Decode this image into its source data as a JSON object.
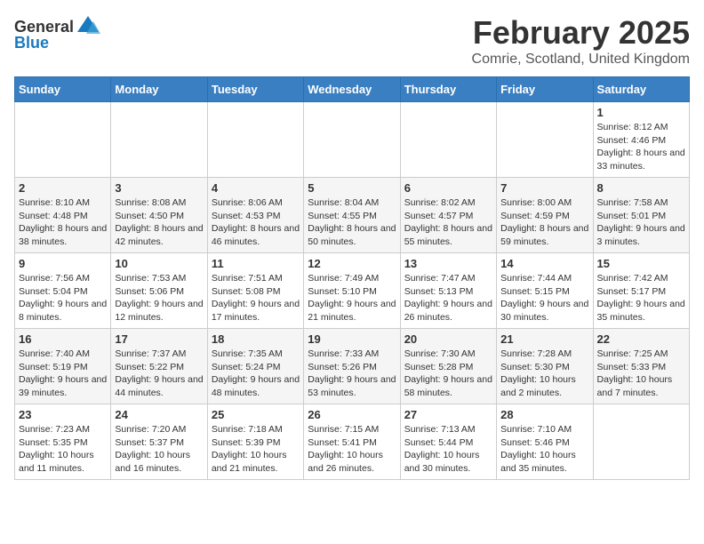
{
  "header": {
    "logo": {
      "text_general": "General",
      "text_blue": "Blue"
    },
    "title": "February 2025",
    "subtitle": "Comrie, Scotland, United Kingdom"
  },
  "weekdays": [
    "Sunday",
    "Monday",
    "Tuesday",
    "Wednesday",
    "Thursday",
    "Friday",
    "Saturday"
  ],
  "weeks": [
    [
      {
        "day": "",
        "info": ""
      },
      {
        "day": "",
        "info": ""
      },
      {
        "day": "",
        "info": ""
      },
      {
        "day": "",
        "info": ""
      },
      {
        "day": "",
        "info": ""
      },
      {
        "day": "",
        "info": ""
      },
      {
        "day": "1",
        "info": "Sunrise: 8:12 AM\nSunset: 4:46 PM\nDaylight: 8 hours and 33 minutes."
      }
    ],
    [
      {
        "day": "2",
        "info": "Sunrise: 8:10 AM\nSunset: 4:48 PM\nDaylight: 8 hours and 38 minutes."
      },
      {
        "day": "3",
        "info": "Sunrise: 8:08 AM\nSunset: 4:50 PM\nDaylight: 8 hours and 42 minutes."
      },
      {
        "day": "4",
        "info": "Sunrise: 8:06 AM\nSunset: 4:53 PM\nDaylight: 8 hours and 46 minutes."
      },
      {
        "day": "5",
        "info": "Sunrise: 8:04 AM\nSunset: 4:55 PM\nDaylight: 8 hours and 50 minutes."
      },
      {
        "day": "6",
        "info": "Sunrise: 8:02 AM\nSunset: 4:57 PM\nDaylight: 8 hours and 55 minutes."
      },
      {
        "day": "7",
        "info": "Sunrise: 8:00 AM\nSunset: 4:59 PM\nDaylight: 8 hours and 59 minutes."
      },
      {
        "day": "8",
        "info": "Sunrise: 7:58 AM\nSunset: 5:01 PM\nDaylight: 9 hours and 3 minutes."
      }
    ],
    [
      {
        "day": "9",
        "info": "Sunrise: 7:56 AM\nSunset: 5:04 PM\nDaylight: 9 hours and 8 minutes."
      },
      {
        "day": "10",
        "info": "Sunrise: 7:53 AM\nSunset: 5:06 PM\nDaylight: 9 hours and 12 minutes."
      },
      {
        "day": "11",
        "info": "Sunrise: 7:51 AM\nSunset: 5:08 PM\nDaylight: 9 hours and 17 minutes."
      },
      {
        "day": "12",
        "info": "Sunrise: 7:49 AM\nSunset: 5:10 PM\nDaylight: 9 hours and 21 minutes."
      },
      {
        "day": "13",
        "info": "Sunrise: 7:47 AM\nSunset: 5:13 PM\nDaylight: 9 hours and 26 minutes."
      },
      {
        "day": "14",
        "info": "Sunrise: 7:44 AM\nSunset: 5:15 PM\nDaylight: 9 hours and 30 minutes."
      },
      {
        "day": "15",
        "info": "Sunrise: 7:42 AM\nSunset: 5:17 PM\nDaylight: 9 hours and 35 minutes."
      }
    ],
    [
      {
        "day": "16",
        "info": "Sunrise: 7:40 AM\nSunset: 5:19 PM\nDaylight: 9 hours and 39 minutes."
      },
      {
        "day": "17",
        "info": "Sunrise: 7:37 AM\nSunset: 5:22 PM\nDaylight: 9 hours and 44 minutes."
      },
      {
        "day": "18",
        "info": "Sunrise: 7:35 AM\nSunset: 5:24 PM\nDaylight: 9 hours and 48 minutes."
      },
      {
        "day": "19",
        "info": "Sunrise: 7:33 AM\nSunset: 5:26 PM\nDaylight: 9 hours and 53 minutes."
      },
      {
        "day": "20",
        "info": "Sunrise: 7:30 AM\nSunset: 5:28 PM\nDaylight: 9 hours and 58 minutes."
      },
      {
        "day": "21",
        "info": "Sunrise: 7:28 AM\nSunset: 5:30 PM\nDaylight: 10 hours and 2 minutes."
      },
      {
        "day": "22",
        "info": "Sunrise: 7:25 AM\nSunset: 5:33 PM\nDaylight: 10 hours and 7 minutes."
      }
    ],
    [
      {
        "day": "23",
        "info": "Sunrise: 7:23 AM\nSunset: 5:35 PM\nDaylight: 10 hours and 11 minutes."
      },
      {
        "day": "24",
        "info": "Sunrise: 7:20 AM\nSunset: 5:37 PM\nDaylight: 10 hours and 16 minutes."
      },
      {
        "day": "25",
        "info": "Sunrise: 7:18 AM\nSunset: 5:39 PM\nDaylight: 10 hours and 21 minutes."
      },
      {
        "day": "26",
        "info": "Sunrise: 7:15 AM\nSunset: 5:41 PM\nDaylight: 10 hours and 26 minutes."
      },
      {
        "day": "27",
        "info": "Sunrise: 7:13 AM\nSunset: 5:44 PM\nDaylight: 10 hours and 30 minutes."
      },
      {
        "day": "28",
        "info": "Sunrise: 7:10 AM\nSunset: 5:46 PM\nDaylight: 10 hours and 35 minutes."
      },
      {
        "day": "",
        "info": ""
      }
    ]
  ]
}
